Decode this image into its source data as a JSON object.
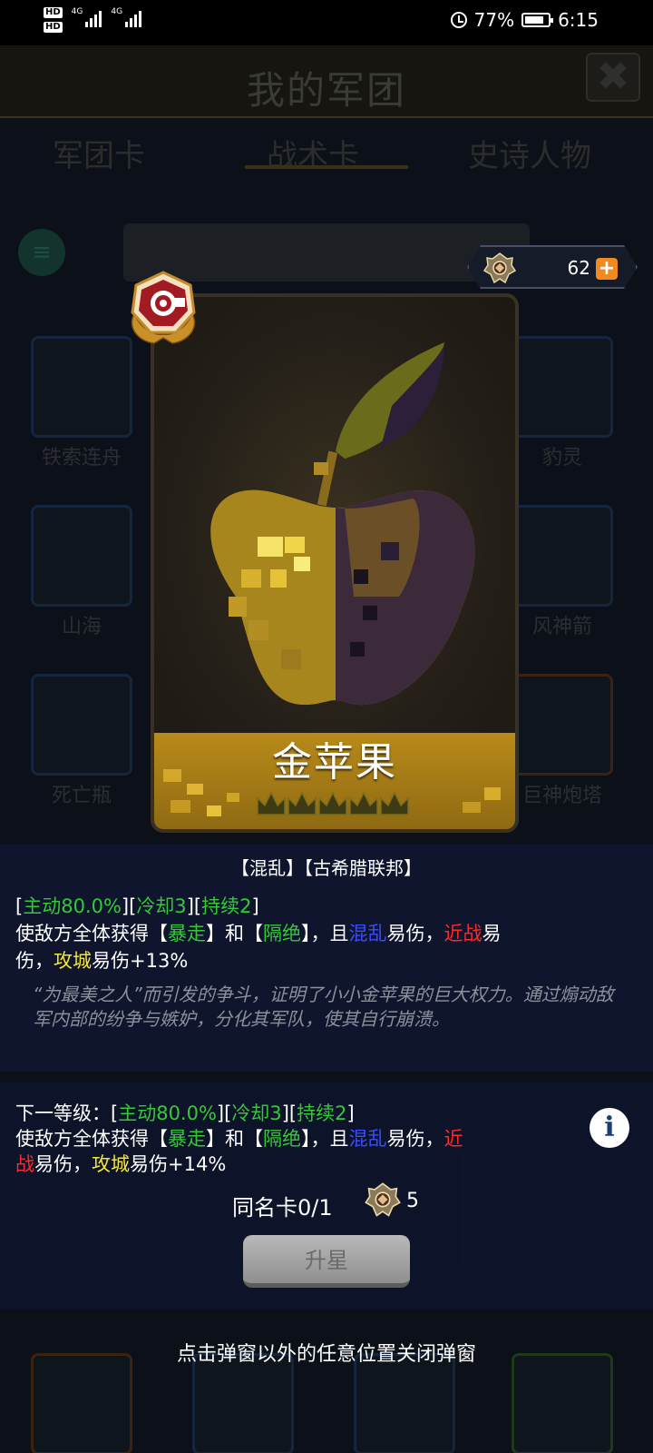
{
  "status_bar": {
    "hd1": "HD",
    "hd2": "HD",
    "net1": "4G",
    "net2": "4G",
    "battery": "77%",
    "time": "6:15"
  },
  "background": {
    "title": "我的军团",
    "close_glyph": "✖",
    "tabs": [
      "军团卡",
      "战术卡",
      "史诗人物"
    ],
    "cards": [
      "铁索连舟",
      "豹灵",
      "山海",
      "风神箭",
      "死亡瓶",
      "巨神炮塔"
    ]
  },
  "medals": {
    "count": "62",
    "plus": "+"
  },
  "card": {
    "name": "金苹果",
    "stars": 5
  },
  "description": {
    "tags": "【混乱】【古希腊联邦】",
    "stats": {
      "active": "主动80.0%",
      "cooldown": "冷却3",
      "duration": "持续2"
    },
    "line2": {
      "p1": "使敌方全体获得【",
      "k1": "暴走",
      "p2": "】和【",
      "k2": "隔绝",
      "p3": "】，且",
      "k3": "混乱",
      "p4": "易伤，",
      "k4": "近战",
      "p5": "易"
    },
    "line3": {
      "p1": "伤，",
      "k1": "攻城",
      "p2": "易伤+13%"
    },
    "flavor": "“为最美之人”而引发的争斗，证明了小小金苹果的巨大权力。通过煽动敌军内部的纷争与嫉妒，分化其军队，使其自行崩溃。"
  },
  "next_level": {
    "prefix": "下一等级：",
    "stats": {
      "active": "主动80.0%",
      "cooldown": "冷却3",
      "duration": "持续2"
    },
    "line2": {
      "p1": "使敌方全体获得【",
      "k1": "暴走",
      "p2": "】和【",
      "k2": "隔绝",
      "p3": "】，且",
      "k3": "混乱",
      "p4": "易伤，",
      "k4": "近"
    },
    "line3": {
      "k1": "战",
      "p1": "易伤，",
      "k2": "攻城",
      "p2": "易伤+14%"
    },
    "info_glyph": "i",
    "duplicate_label": "同名卡0/1",
    "duplicate_cost": "5",
    "upgrade_button": "升星"
  },
  "close_hint": "点击弹窗以外的任意位置关闭弹窗",
  "colors": {
    "green": "#35c83a",
    "blue": "#3a4cff",
    "red": "#ff2a2a",
    "yellow": "#f3e53a",
    "gold": "#c9a227",
    "panel": "#10162e"
  }
}
